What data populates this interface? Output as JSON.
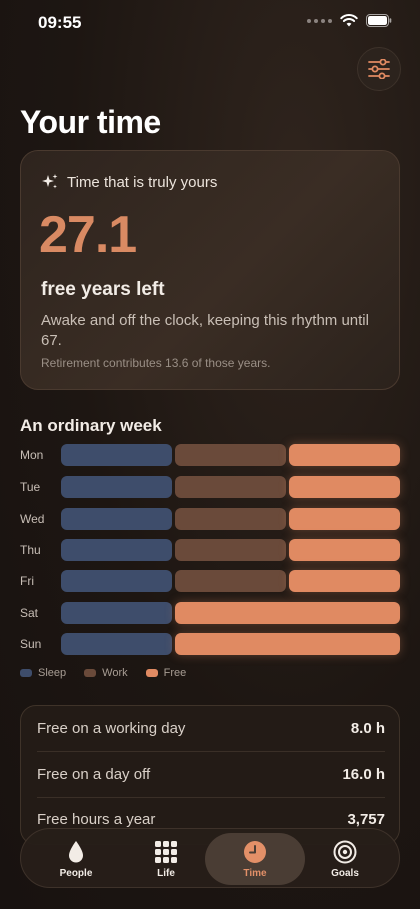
{
  "status": {
    "time": "09:55"
  },
  "page": {
    "title": "Your time"
  },
  "hero": {
    "label": "Time that is truly yours",
    "value": "27.1",
    "unit": "free years left",
    "description": "Awake and off the clock, keeping this rhythm until 67.",
    "note": "Retirement contributes 13.6 of those years."
  },
  "week": {
    "title": "An ordinary week",
    "days": [
      "Mon",
      "Tue",
      "Wed",
      "Thu",
      "Fri",
      "Sat",
      "Sun"
    ],
    "legend": [
      "Sleep",
      "Work",
      "Free"
    ]
  },
  "stats": [
    {
      "label": "Free on a working day",
      "value": "8.0 h"
    },
    {
      "label": "Free on a day off",
      "value": "16.0 h"
    },
    {
      "label": "Free hours a year",
      "value": "3,757"
    }
  ],
  "tabs": [
    {
      "label": "People",
      "icon": "drop-icon"
    },
    {
      "label": "Life",
      "icon": "grid-icon"
    },
    {
      "label": "Time",
      "icon": "clock-icon"
    },
    {
      "label": "Goals",
      "icon": "target-icon"
    }
  ],
  "active_tab": "Time",
  "colors": {
    "sleep": "#3e4d6b",
    "work": "#6a4a3a",
    "free": "#e08a62",
    "accent": "#d98a63"
  }
}
